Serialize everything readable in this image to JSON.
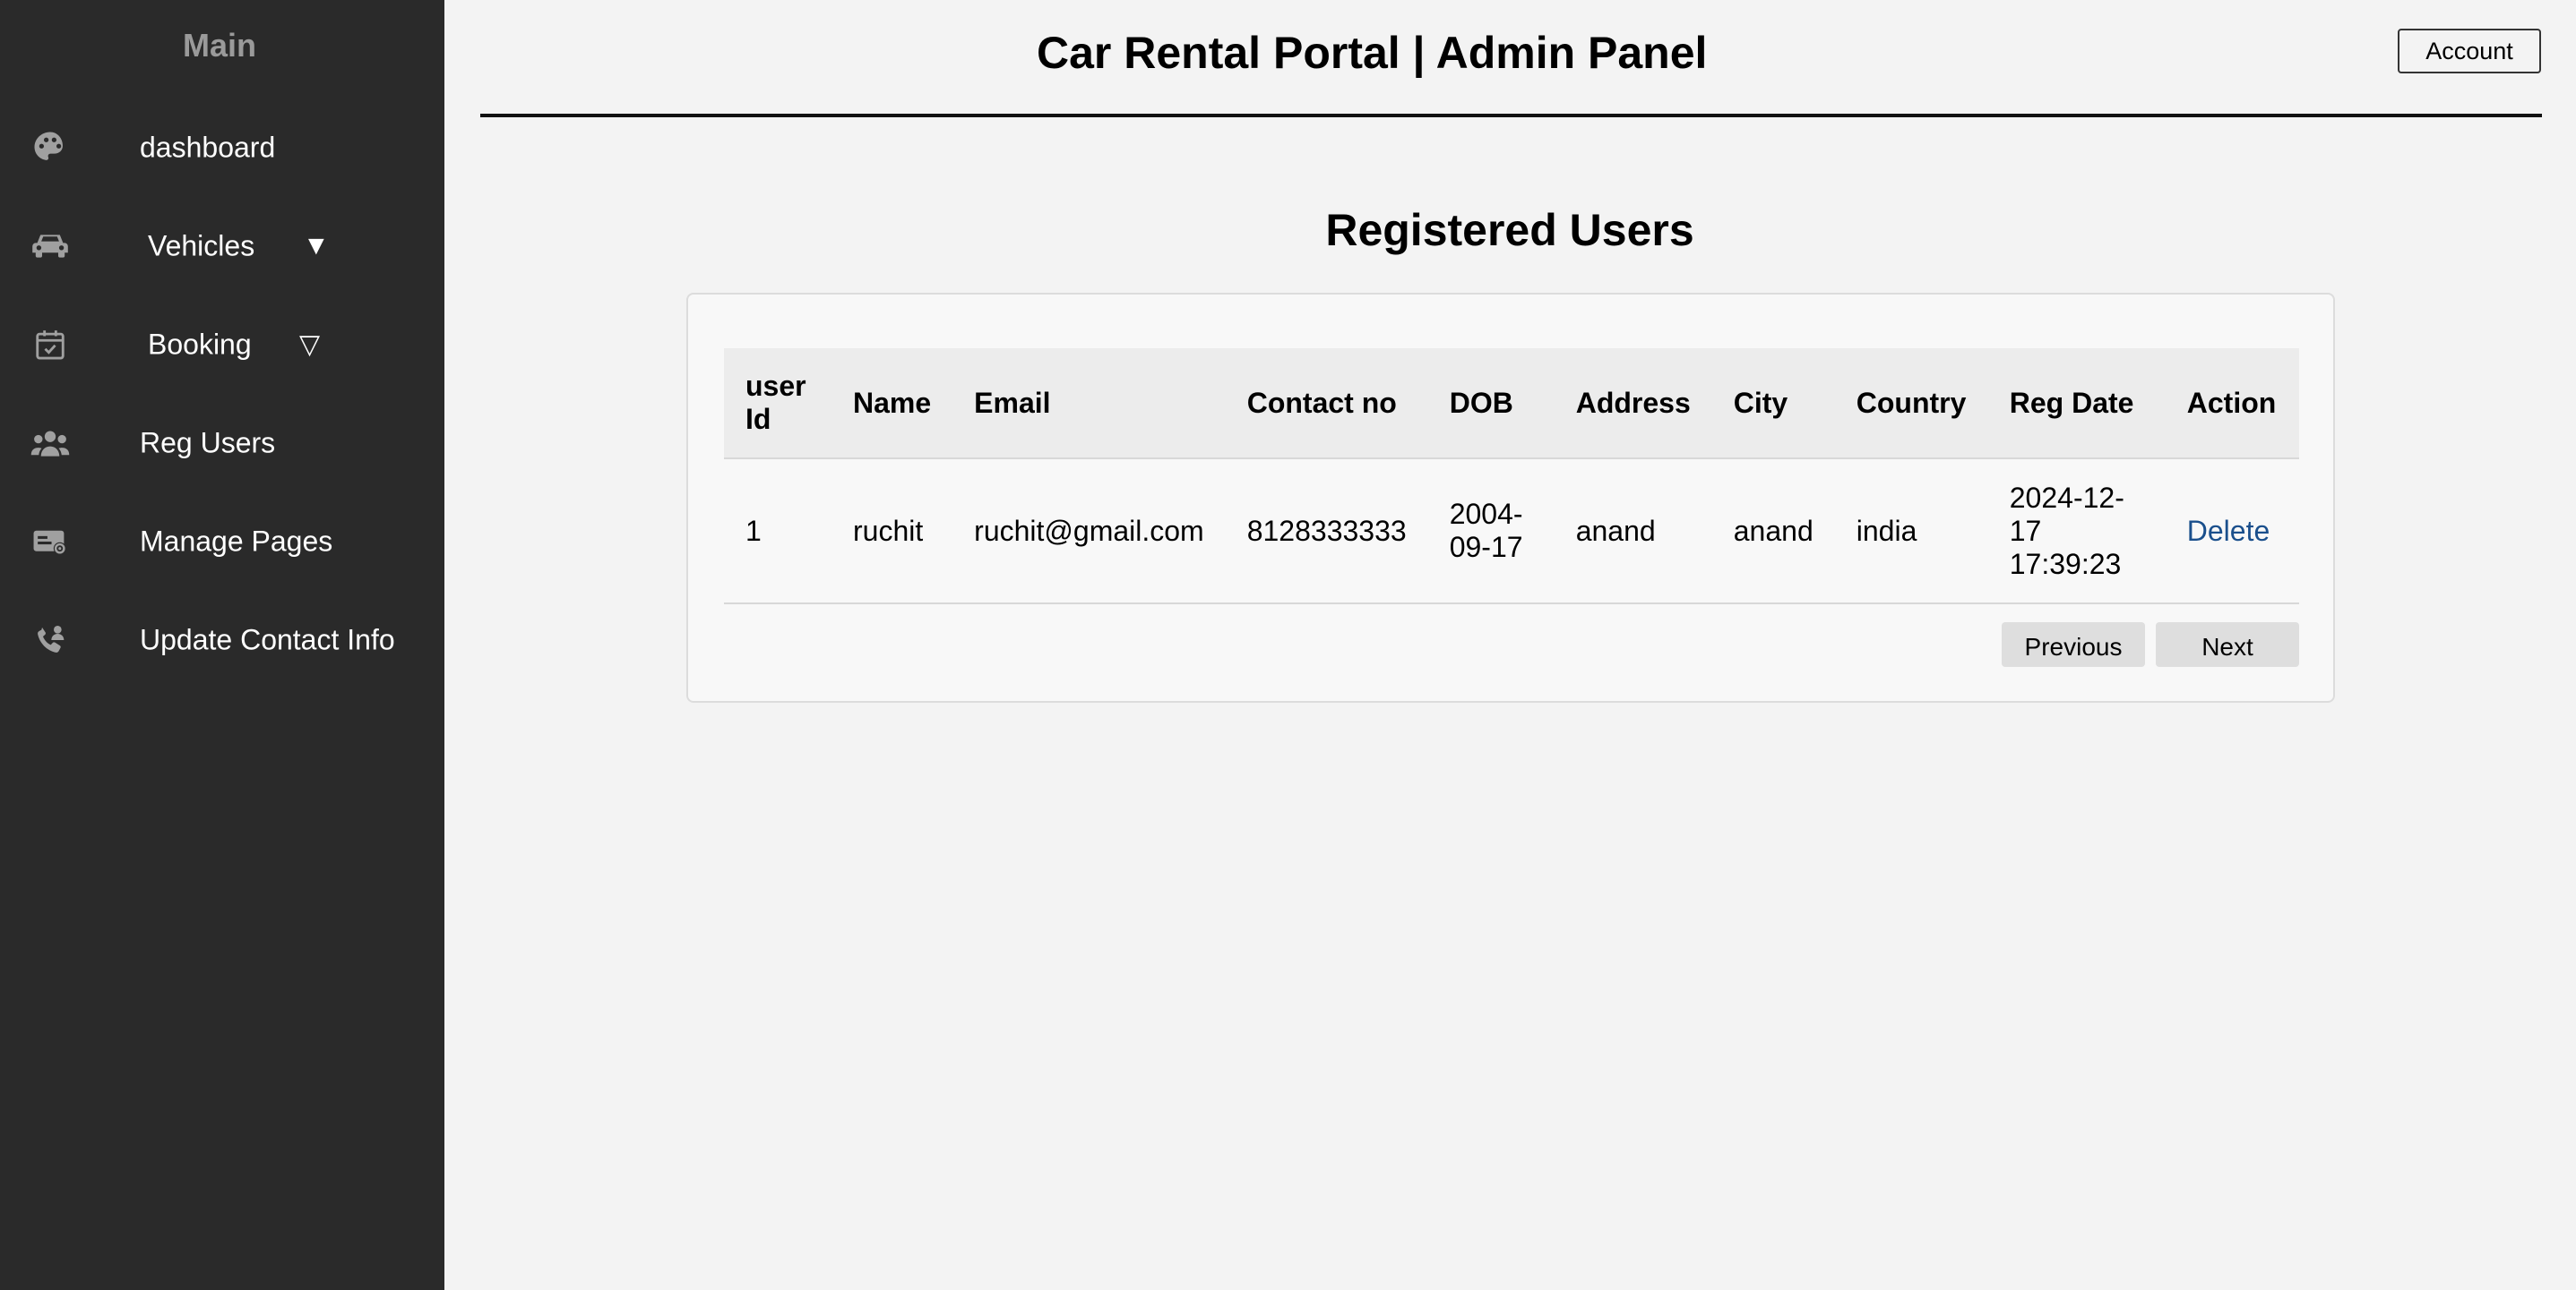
{
  "sidebar": {
    "title": "Main",
    "items": [
      {
        "label": "dashboard",
        "icon": "palette-icon"
      },
      {
        "label": "Vehicles",
        "icon": "car-icon",
        "caret": "▼"
      },
      {
        "label": "Booking",
        "icon": "calendar-check-icon",
        "caret": "▽"
      },
      {
        "label": "Reg Users",
        "icon": "users-icon"
      },
      {
        "label": "Manage Pages",
        "icon": "pages-gear-icon"
      },
      {
        "label": "Update Contact Info",
        "icon": "phone-user-icon"
      }
    ]
  },
  "header": {
    "title": "Car Rental Portal | Admin Panel",
    "account_label": "Account"
  },
  "main": {
    "section_title": "Registered Users",
    "table": {
      "columns": [
        "user Id",
        "Name",
        "Email",
        "Contact no",
        "DOB",
        "Address",
        "City",
        "Country",
        "Reg Date",
        "Action"
      ],
      "rows": [
        {
          "user_id": "1",
          "name": "ruchit",
          "email": "ruchit@gmail.com",
          "contact": "8128333333",
          "dob": "2004-09-17",
          "address": "anand",
          "city": "anand",
          "country": "india",
          "reg_date": "2024-12-17 17:39:23",
          "action": "Delete"
        }
      ]
    },
    "pagination": {
      "previous": "Previous",
      "next": "Next"
    }
  },
  "colors": {
    "sidebar_bg": "#2a2a2a",
    "page_bg": "#f3f3f3",
    "link": "#1a4f8c"
  }
}
